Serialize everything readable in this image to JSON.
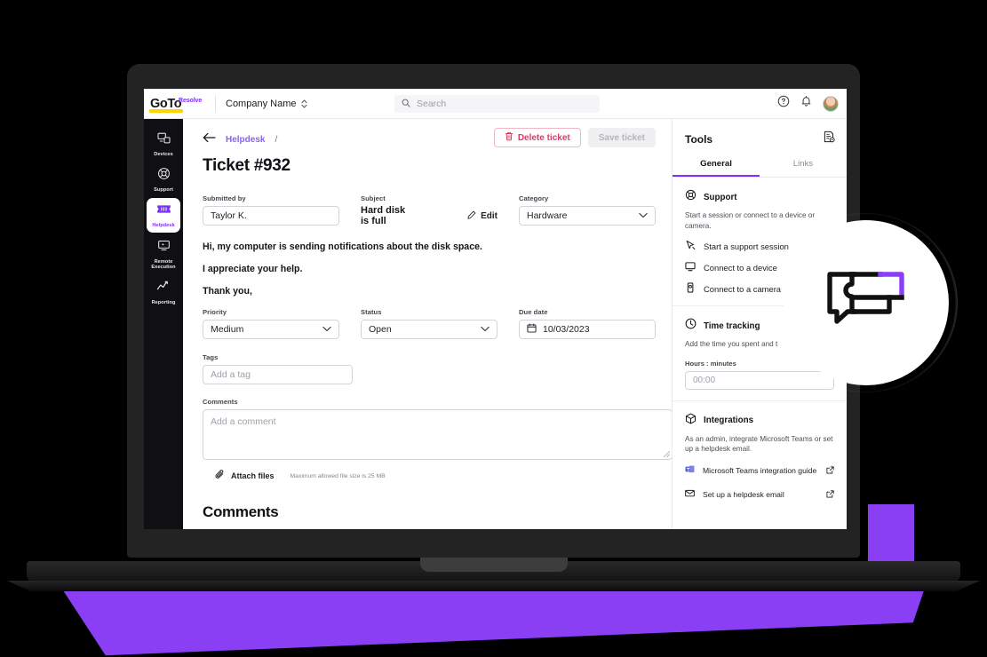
{
  "header": {
    "logo_primary": "GoTo",
    "logo_secondary": "Resolve",
    "company_name": "Company Name",
    "search_placeholder": "Search",
    "help_icon": "help-circle-icon",
    "notification_icon": "bell-icon",
    "avatar_icon": "user-avatar"
  },
  "sidebar": {
    "items": [
      {
        "label": "Devices",
        "icon": "devices-icon",
        "active": false
      },
      {
        "label": "Support",
        "icon": "support-icon",
        "active": false
      },
      {
        "label": "Helpdesk",
        "icon": "helpdesk-ticket-icon",
        "active": true
      },
      {
        "label": "Remote Execution",
        "icon": "remote-execution-icon",
        "active": false
      },
      {
        "label": "Reporting",
        "icon": "reporting-chart-icon",
        "active": false
      }
    ]
  },
  "ticket": {
    "breadcrumb_link": "Helpdesk",
    "breadcrumb_separator": "/",
    "title": "Ticket #932",
    "delete_button": "Delete ticket",
    "save_button": "Save ticket",
    "submitted_by_label": "Submitted by",
    "submitted_by_value": "Taylor K.",
    "subject_label": "Subject",
    "subject_value": "Hard disk is full",
    "edit_label": "Edit",
    "category_label": "Category",
    "category_value": "Hardware",
    "description": [
      "Hi, my computer is sending notifications about the disk space.",
      "I appreciate your help.",
      "Thank you,"
    ],
    "priority_label": "Priority",
    "priority_value": "Medium",
    "status_label": "Status",
    "status_value": "Open",
    "due_date_label": "Due date",
    "due_date_value": "10/03/2023",
    "tags_label": "Tags",
    "tags_placeholder": "Add a tag",
    "comments_label": "Comments",
    "comment_placeholder": "Add a comment",
    "attach_files_label": "Attach files",
    "attach_hint": "Maximum allowed file size is 25 MB",
    "comments_heading": "Comments"
  },
  "tools": {
    "title": "Tools",
    "notes_icon": "notes-settings-icon",
    "tabs": [
      {
        "label": "General",
        "active": true
      },
      {
        "label": "Links",
        "active": false
      }
    ],
    "support": {
      "title": "Support",
      "icon": "support-icon",
      "description": "Start a session or connect to a device or camera.",
      "links": [
        {
          "label": "Start a support session",
          "icon": "cursor-session-icon"
        },
        {
          "label": "Connect to a device",
          "icon": "monitor-icon"
        },
        {
          "label": "Connect to a camera",
          "icon": "mobile-camera-icon"
        }
      ]
    },
    "time_tracking": {
      "title": "Time tracking",
      "icon": "clock-icon",
      "description": "Add the time you spent and t",
      "field_label": "Hours : minutes",
      "field_placeholder": "00:00"
    },
    "integrations": {
      "title": "Integrations",
      "icon": "box-integration-icon",
      "description": "As an admin, integrate Microsoft Teams or set up a helpdesk email.",
      "links": [
        {
          "label": "Microsoft Teams integration guide",
          "icon": "microsoft-teams-icon",
          "external_icon": "external-link-icon"
        },
        {
          "label": "Set up a helpdesk email",
          "icon": "envelope-icon",
          "external_icon": "external-link-icon"
        }
      ]
    }
  },
  "overlay": {
    "badge_icon": "chat-bubbles-icon"
  },
  "colors": {
    "brand_purple": "#7b2ff7",
    "accent_purple": "#8b3ff5",
    "logo_yellow": "#ffd400",
    "danger": "#e03a63",
    "background": "#000000"
  }
}
